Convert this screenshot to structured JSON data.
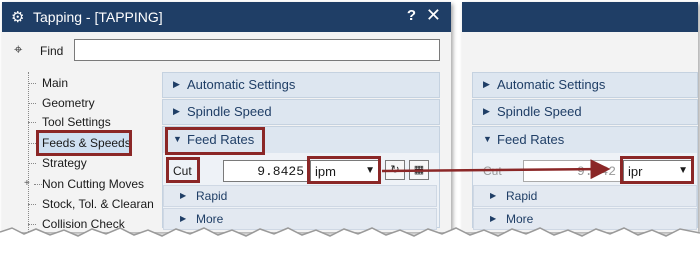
{
  "window": {
    "title": "Tapping - [TAPPING]",
    "help_glyph": "?",
    "close_glyph": "✕",
    "gear_glyph": "⚙"
  },
  "find": {
    "label": "Find",
    "value": "",
    "icon": "binoculars-icon",
    "icon_glyph": "⌖"
  },
  "tree": {
    "items": [
      "Main",
      "Geometry",
      "Tool Settings",
      "Feeds & Speeds",
      "Strategy",
      "Non Cutting Moves",
      "Stock, Tol. & Clearan",
      "Collision Check"
    ],
    "expander_glyph": "+",
    "highlighted": "Feeds & Speeds"
  },
  "sections": {
    "automatic": "Automatic Settings",
    "spindle": "Spindle Speed",
    "feed_rates": "Feed Rates",
    "rapid": "Rapid",
    "more": "More"
  },
  "glyphs": {
    "collapsed": "▶",
    "expanded": "▼",
    "dropdown": "▼"
  },
  "left_feed": {
    "cut_label": "Cut",
    "cut_value": "9.8425",
    "unit": "ipm",
    "btn1_icon": "calculator-icon",
    "btn1_glyph": "↻",
    "btn2_icon": "table-icon",
    "btn2_glyph": "▦"
  },
  "right_feed": {
    "cut_label": "Cut",
    "cut_value": "9.842",
    "unit": "ipr"
  },
  "colors": {
    "titlebar": "#1f3e66",
    "highlight": "#8b2727",
    "section": "#dde6f0",
    "selection": "#cfe0f2"
  }
}
